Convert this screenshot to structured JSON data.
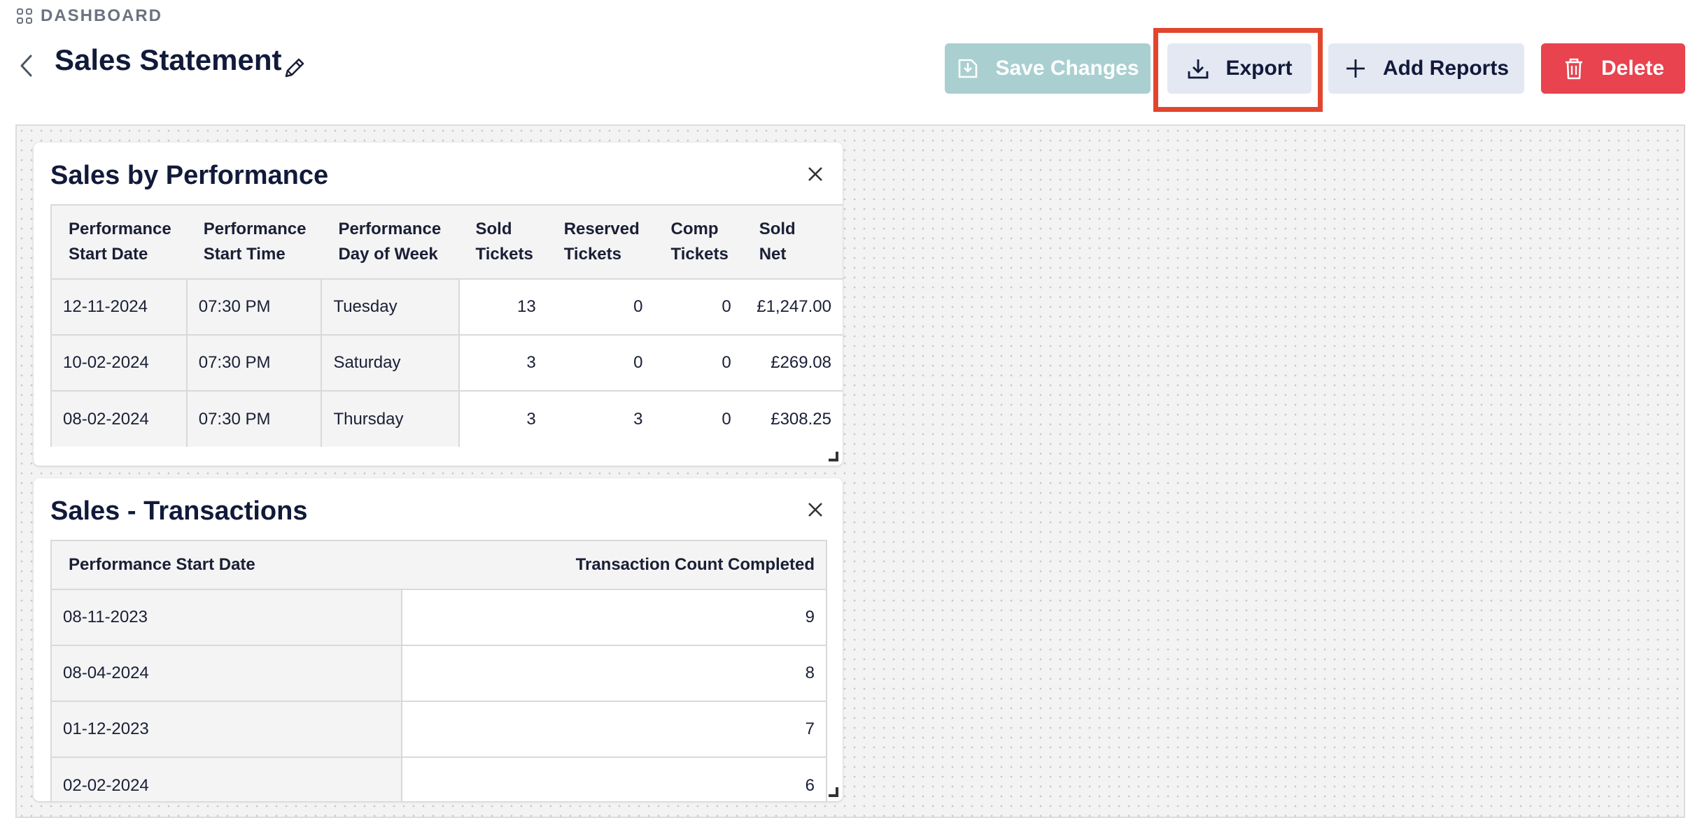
{
  "breadcrumb": {
    "icon": "dashboard-grid-icon",
    "label": "DASHBOARD"
  },
  "header": {
    "title": "Sales Statement",
    "buttons": {
      "save": {
        "label": "Save Changes",
        "icon": "save-icon"
      },
      "export": {
        "label": "Export",
        "icon": "download-icon"
      },
      "add": {
        "label": "Add Reports",
        "icon": "plus-icon"
      },
      "delete": {
        "label": "Delete",
        "icon": "trash-icon"
      }
    }
  },
  "colors": {
    "save": "#a9cfd1",
    "secondary": "#e3e8f2",
    "delete": "#e8434f",
    "highlight": "#e2452d",
    "title": "#111a3a"
  },
  "reports": [
    {
      "title": "Sales by Performance",
      "columns": [
        [
          "Performance",
          "Start Date"
        ],
        [
          "Performance",
          "Start Time"
        ],
        [
          "Performance",
          "Day of Week"
        ],
        [
          "Sold",
          "Tickets"
        ],
        [
          "Reserved",
          "Tickets"
        ],
        [
          "Comp",
          "Tickets"
        ],
        [
          "Sold",
          "Net"
        ]
      ],
      "rows": [
        [
          "12-11-2024",
          "07:30 PM",
          "Tuesday",
          "13",
          "0",
          "0",
          "£1,247.00"
        ],
        [
          "10-02-2024",
          "07:30 PM",
          "Saturday",
          "3",
          "0",
          "0",
          "£269.08"
        ],
        [
          "08-02-2024",
          "07:30 PM",
          "Thursday",
          "3",
          "3",
          "0",
          "£308.25"
        ]
      ]
    },
    {
      "title": "Sales - Transactions",
      "columns": [
        "Performance Start Date",
        "Transaction Count Completed"
      ],
      "rows": [
        [
          "08-11-2023",
          "9"
        ],
        [
          "08-04-2024",
          "8"
        ],
        [
          "01-12-2023",
          "7"
        ],
        [
          "02-02-2024",
          "6"
        ]
      ]
    }
  ]
}
